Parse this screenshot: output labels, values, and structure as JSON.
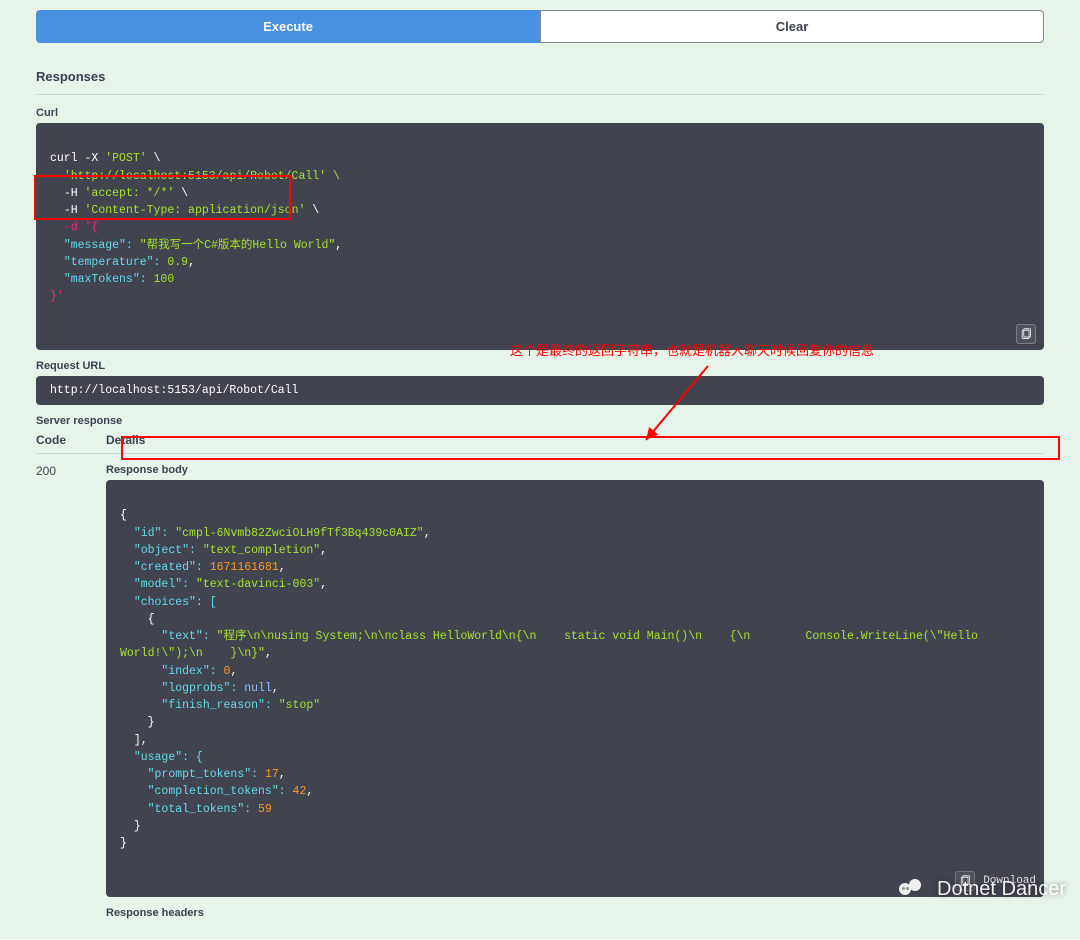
{
  "buttons": {
    "execute": "Execute",
    "clear": "Clear"
  },
  "sections": {
    "responses": "Responses",
    "curl": "Curl",
    "request_url": "Request URL",
    "server_response": "Server response",
    "code_header": "Code",
    "details_header": "Details",
    "response_body": "Response body",
    "response_headers": "Response headers"
  },
  "status_code": "200",
  "curl_command": {
    "line1a": "curl -X ",
    "line1b": "'POST'",
    "line1c": " \\",
    "line2": "  'http://localhost:5153/api/Robot/Call' \\",
    "line3a": "  -H ",
    "line3b": "'accept: */*'",
    "line3c": " \\",
    "line4a": "  -H ",
    "line4b": "'Content-Type: application/json'",
    "line4c": " \\",
    "line5": "  -d '{",
    "line6a": "  \"message\": ",
    "line6b": "\"帮我写一个C#版本的Hello World\"",
    "line6c": ",",
    "line7a": "  \"temperature\": ",
    "line7b": "0.9",
    "line7c": ",",
    "line8a": "  \"maxTokens\": ",
    "line8b": "100",
    "line9": "}'"
  },
  "request_url_value": "http://localhost:5153/api/Robot/Call",
  "response_body": {
    "open": "{",
    "id_k": "  \"id\": ",
    "id_v": "\"cmpl-6Nvmb82ZwciOLH9fTf3Bq439c0AIZ\"",
    "comma": ",",
    "object_k": "  \"object\": ",
    "object_v": "\"text_completion\"",
    "created_k": "  \"created\": ",
    "created_v": "1671161681",
    "model_k": "  \"model\": ",
    "model_v": "\"text-davinci-003\"",
    "choices_k": "  \"choices\": [",
    "choice_open": "    {",
    "text_k": "      \"text\": ",
    "text_v": "\"程序\\n\\nusing System;\\n\\nclass HelloWorld\\n{\\n    static void Main()\\n    {\\n        Console.WriteLine(\\\"Hello World!\\\");\\n    }\\n}\"",
    "index_k": "      \"index\": ",
    "index_v": "0",
    "logprobs_k": "      \"logprobs\": ",
    "logprobs_v": "null",
    "finish_k": "      \"finish_reason\": ",
    "finish_v": "\"stop\"",
    "choice_close": "    }",
    "choices_close": "  ],",
    "usage_k": "  \"usage\": {",
    "pt_k": "    \"prompt_tokens\": ",
    "pt_v": "17",
    "ct_k": "    \"completion_tokens\": ",
    "ct_v": "42",
    "tt_k": "    \"total_tokens\": ",
    "tt_v": "59",
    "usage_close": "  }",
    "close": "}"
  },
  "annotation": "这个是最终的返回字符串，也就是机器人聊天时候回复你的信息",
  "download_label": "Download",
  "watermark": "Dotnet Dancer"
}
